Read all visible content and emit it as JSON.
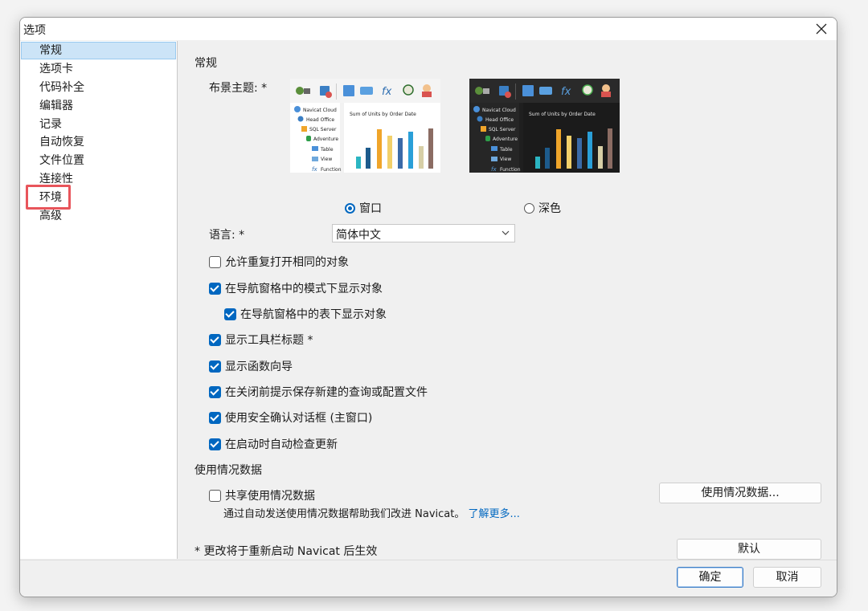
{
  "window": {
    "title": "选项"
  },
  "sidebar": {
    "items": [
      {
        "label": "常规"
      },
      {
        "label": "选项卡"
      },
      {
        "label": "代码补全"
      },
      {
        "label": "编辑器"
      },
      {
        "label": "记录"
      },
      {
        "label": "自动恢复"
      },
      {
        "label": "文件位置"
      },
      {
        "label": "连接性"
      },
      {
        "label": "环境"
      },
      {
        "label": "高级"
      }
    ],
    "selected_index": 0,
    "highlighted_index": 8
  },
  "general": {
    "section_title": "常规",
    "theme_label": "布景主题: *",
    "themes": [
      {
        "label": "窗口",
        "selected": true
      },
      {
        "label": "深色",
        "selected": false
      }
    ],
    "theme_preview": {
      "tree_items": [
        "Navicat Cloud",
        "Head Office",
        "SQL Server",
        "Adventure",
        "Table",
        "View",
        "Function"
      ],
      "chart_title": "Sum of Units by Order Date"
    },
    "language_label": "语言: *",
    "language_value": "简体中文",
    "options": [
      {
        "label": "允许重复打开相同的对象",
        "checked": false
      },
      {
        "label": "在导航窗格中的模式下显示对象",
        "checked": true
      },
      {
        "label": "在导航窗格中的表下显示对象",
        "checked": true
      },
      {
        "label": "显示工具栏标题 *",
        "checked": true
      },
      {
        "label": "显示函数向导",
        "checked": true
      },
      {
        "label": "在关闭前提示保存新建的查询或配置文件",
        "checked": true
      },
      {
        "label": "使用安全确认对话框 (主窗口)",
        "checked": true
      },
      {
        "label": "在启动时自动检查更新",
        "checked": true
      }
    ]
  },
  "usage": {
    "section_title": "使用情况数据",
    "share_label": "共享使用情况数据",
    "share_checked": false,
    "description": "通过自动发送使用情况数据帮助我们改进 Navicat。",
    "learn_more": "了解更多...",
    "data_button": "使用情况数据..."
  },
  "footnote": "* 更改将于重新启动 Navicat 后生效",
  "buttons": {
    "default": "默认",
    "ok": "确定",
    "cancel": "取消"
  },
  "colors": {
    "accent": "#0067c0",
    "highlight_box": "#e8555b",
    "selection": "#cce4f7",
    "dark_theme_bg": "#1f1f1f"
  }
}
